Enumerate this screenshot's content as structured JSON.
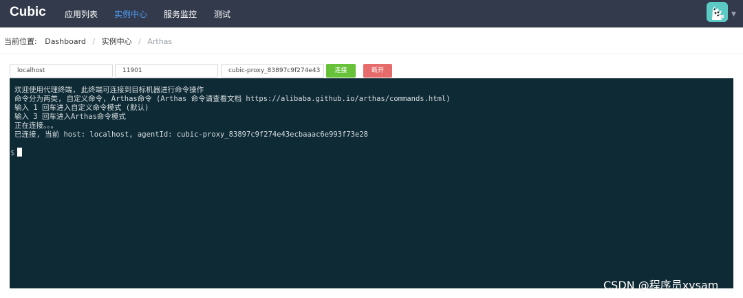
{
  "header": {
    "brand": "Cubic",
    "nav": [
      {
        "label": "应用列表",
        "active": false
      },
      {
        "label": "实例中心",
        "active": true
      },
      {
        "label": "服务监控",
        "active": false
      },
      {
        "label": "测试",
        "active": false
      }
    ]
  },
  "breadcrumb": {
    "prefix": "当前位置:",
    "items": [
      "Dashboard",
      "实例中心",
      "Arthas"
    ],
    "separator": "/"
  },
  "toolbar": {
    "host": "localhost",
    "port": "11901",
    "agent_id": "cubic-proxy_83897c9f274e43",
    "connect_label": "连接",
    "disconnect_label": "断开"
  },
  "terminal": {
    "lines": [
      "欢迎使用代理终端, 此终端可连接到目标机器进行命令操作",
      "命令分为两类, 自定义命令, Arthas命令 (Arthas 命令请查看文档 https://alibaba.github.io/arthas/commands.html)",
      "输入 1 回车进入自定义命令模式 (默认)",
      "输入 3 回车进入Arthas命令模式",
      "正在连接。。。",
      "已连接, 当前 host: localhost, agentId: cubic-proxy_83897c9f274e43ecbaaac6e993f73e28"
    ],
    "prompt": "$"
  },
  "watermark": "CSDN @程序员xysam",
  "colors": {
    "navbar": "#323a4b",
    "active_nav": "#4d9bf2",
    "terminal_bg": "#0e2a35",
    "connect": "#67c23a",
    "disconnect": "#e66c6c"
  }
}
